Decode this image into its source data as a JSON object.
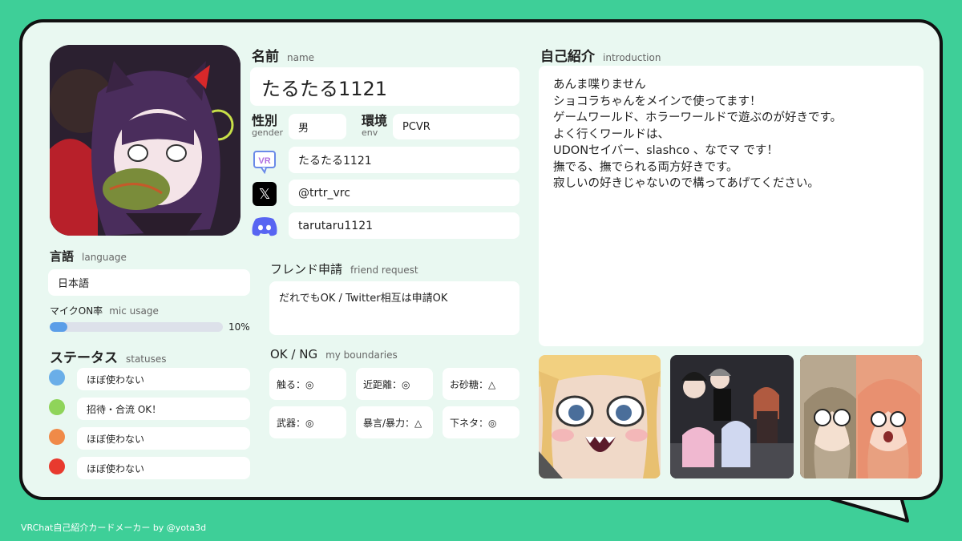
{
  "name": {
    "label_jp": "名前",
    "label_en": "name",
    "value": "たるたる1121"
  },
  "gender": {
    "label_jp": "性別",
    "label_en": "gender",
    "value": "男"
  },
  "env": {
    "label_jp": "環境",
    "label_en": "env",
    "value": "PCVR"
  },
  "socials": {
    "vrchat": {
      "icon": "vrchat-icon",
      "icon_text": "VR",
      "value": "たるたる1121"
    },
    "x": {
      "icon": "x-icon",
      "icon_text": "𝕏",
      "value": "@trtr_vrc"
    },
    "discord": {
      "icon": "discord-icon",
      "value": "tarutaru1121"
    }
  },
  "language": {
    "label_jp": "言語",
    "label_en": "language",
    "value": "日本語"
  },
  "mic": {
    "label_jp": "マイクON率",
    "label_en": "mic usage",
    "value": "10%",
    "fraction": 0.1,
    "bar_color": "#5b9ee8"
  },
  "statuses": {
    "label_jp": "ステータス",
    "label_en": "statuses",
    "items": [
      {
        "color": "#6aaee8",
        "text": "ほぼ使わない"
      },
      {
        "color": "#8fd45a",
        "text": "招待・合流 OK！"
      },
      {
        "color": "#f08a48",
        "text": "ほぼ使わない"
      },
      {
        "color": "#e83a2e",
        "text": "ほぼ使わない"
      }
    ]
  },
  "friend_request": {
    "label_jp": "フレンド申請",
    "label_en": "friend request",
    "value": "だれでもOK / Twitter相互は申請OK"
  },
  "boundaries": {
    "label_jp": "OK / NG",
    "label_en": "my boundaries",
    "items": [
      "触る：◎",
      "近距離：◎",
      "お砂糖：△",
      "武器：◎",
      "暴言/暴力：△",
      "下ネタ：◎"
    ]
  },
  "intro": {
    "label_jp": "自己紹介",
    "label_en": "introduction",
    "lines": [
      "あんま喋りません",
      "ショコラちゃんをメインで使ってます！",
      "ゲームワールド、ホラーワールドで遊ぶのが好きです。",
      "よく行くワールドは、",
      "UDONセイバー、slashco 、なでマ です！",
      "撫でる、撫でられる両方好きです。",
      "寂しいの好きじゃないので構ってあげてください。"
    ]
  },
  "footer": "VRChat自己紹介カードメーカー by @yota3d",
  "colors": {
    "background": "#3ecf98",
    "card": "#e9f8f1",
    "field": "#ffffff"
  }
}
